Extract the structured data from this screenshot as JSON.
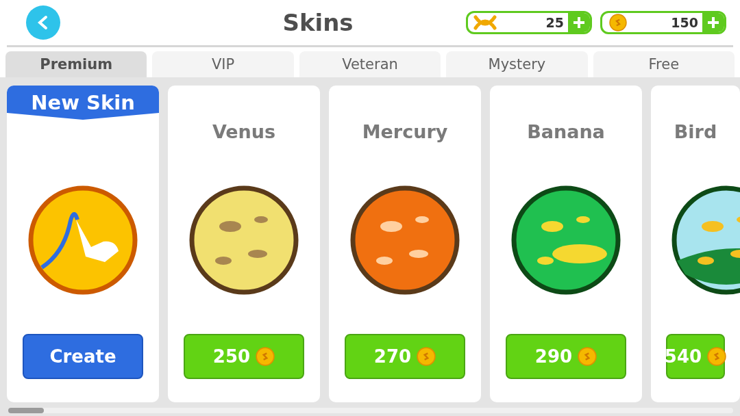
{
  "header": {
    "title": "Skins"
  },
  "currencies": [
    {
      "kind": "dna",
      "amount": "25"
    },
    {
      "kind": "coin",
      "amount": "150"
    }
  ],
  "tabs": [
    {
      "label": "Premium",
      "selected": true
    },
    {
      "label": "VIP",
      "selected": false
    },
    {
      "label": "Veteran",
      "selected": false
    },
    {
      "label": "Mystery",
      "selected": false
    },
    {
      "label": "Free",
      "selected": false
    }
  ],
  "cards": [
    {
      "kind": "create",
      "banner": "New Skin",
      "button": "Create"
    },
    {
      "kind": "skin",
      "name": "Venus",
      "price": "250"
    },
    {
      "kind": "skin",
      "name": "Mercury",
      "price": "270"
    },
    {
      "kind": "skin",
      "name": "Banana",
      "price": "290"
    },
    {
      "kind": "skin",
      "name": "Bird",
      "price": "540"
    }
  ]
}
